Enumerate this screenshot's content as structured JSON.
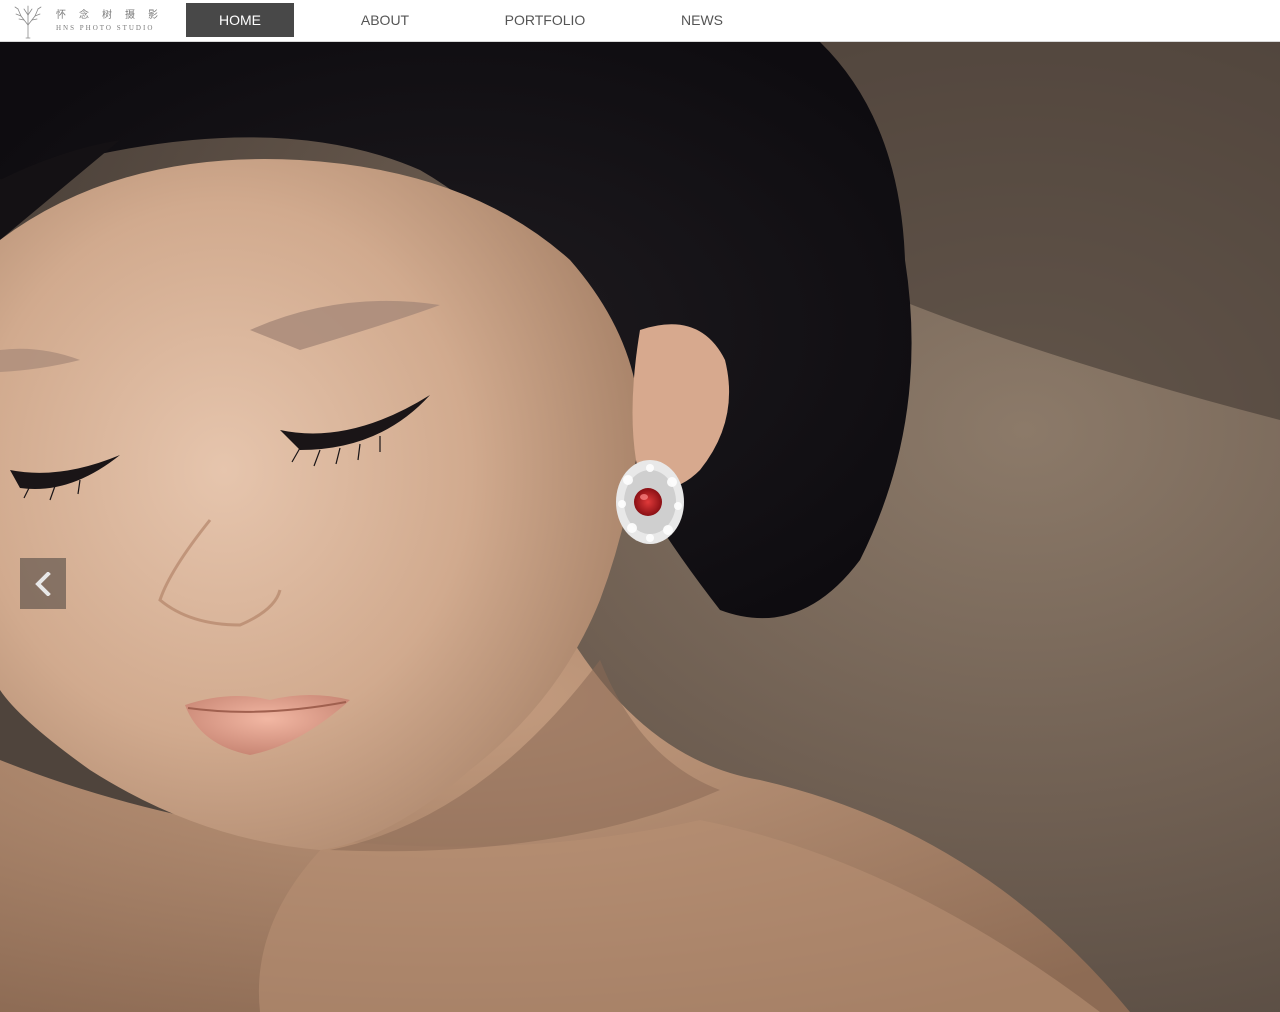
{
  "header": {
    "logo": {
      "cn_text": "怀念树摄影",
      "en_text": "HNS PHOTO STUDIO",
      "icon": "tree-icon"
    },
    "nav": [
      {
        "label": "HOME",
        "active": true
      },
      {
        "label": "ABOUT",
        "active": false
      },
      {
        "label": "PORTFOLIO",
        "active": false
      },
      {
        "label": "NEWS",
        "active": false
      }
    ]
  },
  "hero": {
    "image": "portrait-photo",
    "prev_icon": "chevron-left-icon"
  },
  "colors": {
    "nav_active_bg": "#484848",
    "nav_text": "#555555",
    "header_bg": "#ffffff"
  }
}
